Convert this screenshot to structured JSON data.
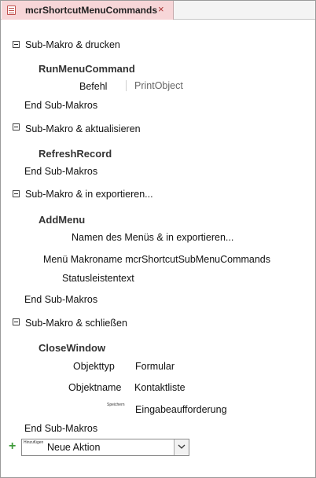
{
  "tab": {
    "title": "mcrShortcutMenuCommands",
    "close_icon": "×"
  },
  "blocks": [
    {
      "header": "Sub-Makro & drucken"
    },
    {
      "header": "Sub-Makro & aktualisieren"
    },
    {
      "header": "Sub-Makro & in exportieren..."
    },
    {
      "header": "Sub-Makro & schließen"
    }
  ],
  "end_label": "End Sub-Makros",
  "actions": {
    "run_menu": {
      "name": "RunMenuCommand",
      "arg_label": "Befehl",
      "arg_value": "PrintObject"
    },
    "refresh": {
      "name": "RefreshRecord"
    },
    "add_menu": {
      "name": "AddMenu",
      "line1": "Namen des Menüs & in exportieren...",
      "line2": "Menü Makroname mcrShortcutSubMenuCommands",
      "line3": "Statusleistentext"
    },
    "close_window": {
      "name": "CloseWindow",
      "arg1_label": "Objekttyp",
      "arg1_value": "Formular",
      "arg2_label": "Objektname",
      "arg2_value": "Kontaktliste",
      "arg3_label": "Speichern",
      "arg3_value": "Eingabeaufforderung"
    }
  },
  "add_action": {
    "tag": "Hinzufügen",
    "value": "Neue Aktion",
    "plus": "+"
  }
}
